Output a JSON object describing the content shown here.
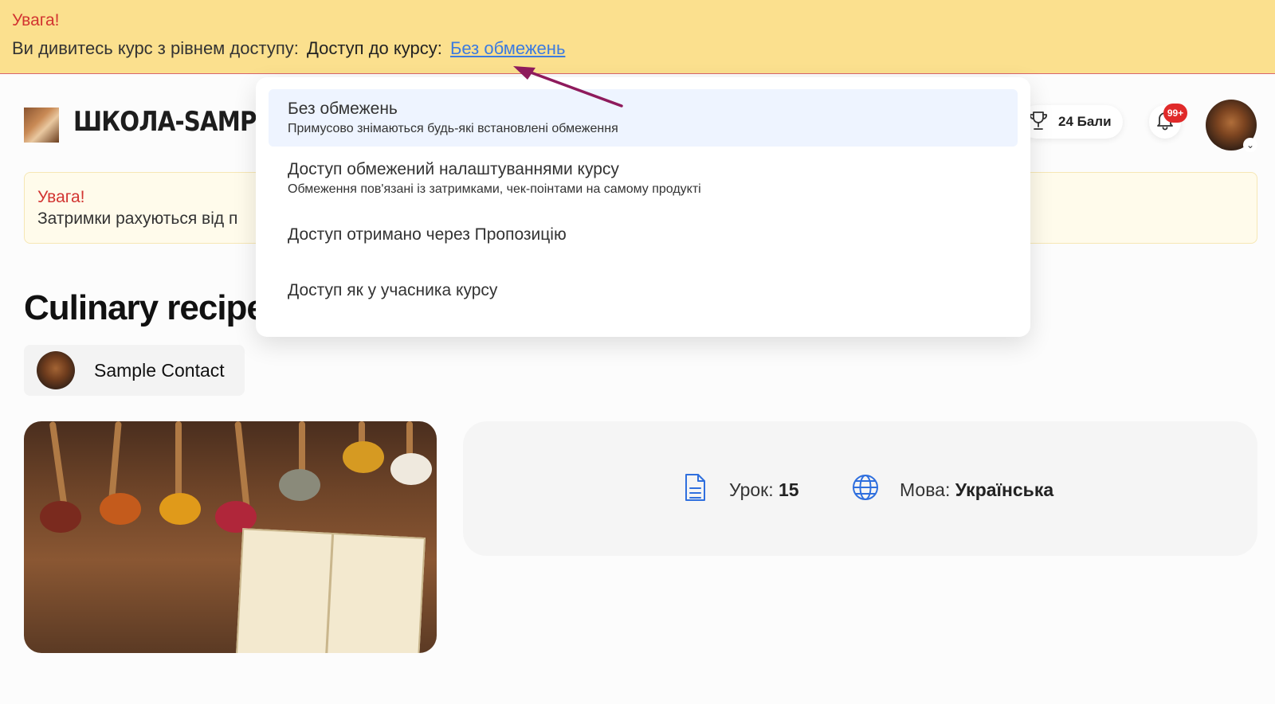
{
  "banner": {
    "warning_title": "Увага!",
    "viewing_text": "Ви дивитесь курс з рівнем доступу:",
    "level_label": "Доступ до курсу:",
    "level_link": "Без обмежень"
  },
  "header": {
    "logo_text": "ШКОЛА-SAMPLE",
    "points": "24 Бали",
    "notification_badge": "99+"
  },
  "notice": {
    "title": "Увага!",
    "text": "Затримки рахуються від п"
  },
  "course": {
    "title": "Culinary recipes",
    "author": "Sample Contact"
  },
  "info": {
    "lessons_label": "Урок:",
    "lessons_value": "15",
    "language_label": "Мова:",
    "language_value": "Українська"
  },
  "dropdown": {
    "items": [
      {
        "title": "Без обмежень",
        "subtitle": "Примусово знімаються будь-які встановлені обмеження"
      },
      {
        "title": "Доступ обмежений налаштуваннями курсу",
        "subtitle": "Обмеження пов'язані із затримками, чек-поінтами на самому продукті"
      },
      {
        "title": "Доступ отримано через Пропозицію"
      },
      {
        "title": "Доступ як у учасника курсу"
      }
    ]
  },
  "colors": {
    "banner_bg": "#fbe08e",
    "warning_red": "#d23431",
    "link_blue": "#3c7be0",
    "arrow_color": "#8e1a5c",
    "active_item_bg": "#eef4ff",
    "icon_blue": "#2f6fde"
  },
  "icons": [
    "trophy-icon",
    "bell-icon",
    "chevron-down-icon",
    "document-icon",
    "globe-icon"
  ]
}
